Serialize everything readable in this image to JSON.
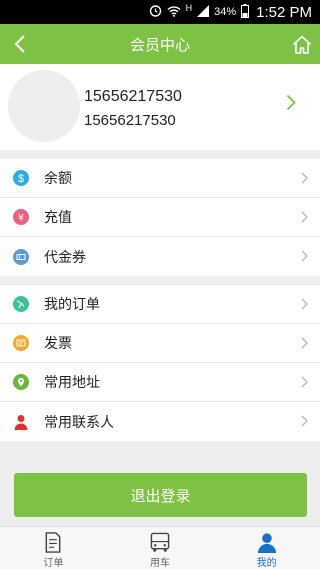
{
  "status_bar": {
    "battery": "34%",
    "time": "1:52 PM",
    "network": "H"
  },
  "header": {
    "title": "会员中心"
  },
  "profile": {
    "phone_primary": "15656217530",
    "phone_secondary": "15656217530"
  },
  "account_menu": [
    {
      "label": "余额",
      "icon": "dollar-icon",
      "color": "#2aaee0"
    },
    {
      "label": "充值",
      "icon": "yen-icon",
      "color": "#e8637f"
    },
    {
      "label": "代金券",
      "icon": "coupon-icon",
      "color": "#5b9bd5"
    }
  ],
  "service_menu": [
    {
      "label": "我的订单",
      "icon": "globe-icon",
      "color": "#3cc19a"
    },
    {
      "label": "发票",
      "icon": "invoice-icon",
      "color": "#f0a830"
    },
    {
      "label": "常用地址",
      "icon": "location-icon",
      "color": "#6cb63c"
    },
    {
      "label": "常用联系人",
      "icon": "person-icon",
      "color": "#e0302e"
    }
  ],
  "logout_label": "退出登录",
  "tabs": [
    {
      "label": "订单",
      "icon": "document-icon"
    },
    {
      "label": "用车",
      "icon": "bus-icon"
    },
    {
      "label": "我的",
      "icon": "user-icon",
      "active": true
    }
  ],
  "colors": {
    "brand": "#7dc145",
    "active_tab": "#1a6fc7"
  }
}
